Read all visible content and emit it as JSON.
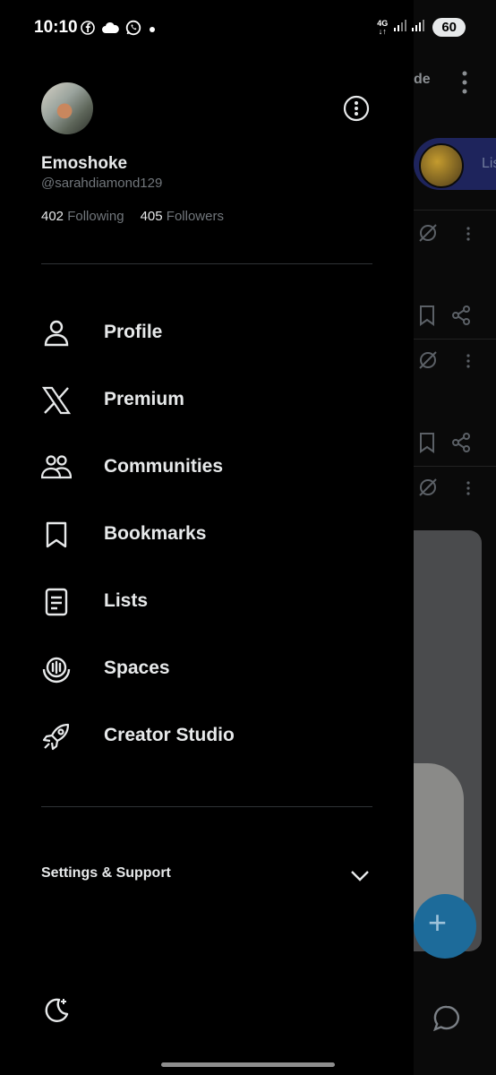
{
  "status_bar": {
    "time": "10:10",
    "network": "4G",
    "battery": "60"
  },
  "account": {
    "name": "Emoshoke",
    "handle": "@sarahdiamond129",
    "following_count": "402",
    "following_label": "Following",
    "followers_count": "405",
    "followers_label": "Followers"
  },
  "menu": [
    {
      "label": "Profile",
      "icon": "person-icon"
    },
    {
      "label": "Premium",
      "icon": "x-logo-icon"
    },
    {
      "label": "Communities",
      "icon": "communities-icon"
    },
    {
      "label": "Bookmarks",
      "icon": "bookmark-icon"
    },
    {
      "label": "Lists",
      "icon": "list-icon"
    },
    {
      "label": "Spaces",
      "icon": "spaces-icon"
    },
    {
      "label": "Creator Studio",
      "icon": "rocket-icon"
    }
  ],
  "settings_support": {
    "label": "Settings & Support"
  },
  "background_feed": {
    "header_fragment": "de",
    "pill_fragment": "Lis"
  },
  "colors": {
    "background": "#000000",
    "text": "#e7e9ea",
    "secondary_text": "#71767b",
    "divider": "#2f3336",
    "fab": "#1d9bf0"
  }
}
